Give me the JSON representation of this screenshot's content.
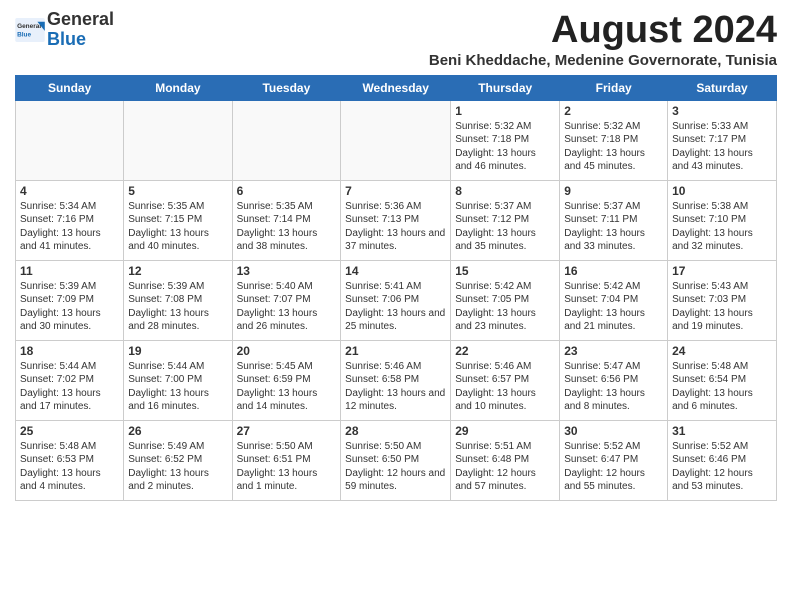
{
  "header": {
    "logo": {
      "general": "General",
      "blue": "Blue"
    },
    "title": "August 2024",
    "subtitle": "Beni Kheddache, Medenine Governorate, Tunisia"
  },
  "calendar": {
    "days_of_week": [
      "Sunday",
      "Monday",
      "Tuesday",
      "Wednesday",
      "Thursday",
      "Friday",
      "Saturday"
    ],
    "weeks": [
      [
        {
          "day": "",
          "empty": true
        },
        {
          "day": "",
          "empty": true
        },
        {
          "day": "",
          "empty": true
        },
        {
          "day": "",
          "empty": true
        },
        {
          "day": "1",
          "sunrise": "5:32 AM",
          "sunset": "7:18 PM",
          "daylight": "13 hours and 46 minutes."
        },
        {
          "day": "2",
          "sunrise": "5:32 AM",
          "sunset": "7:18 PM",
          "daylight": "13 hours and 45 minutes."
        },
        {
          "day": "3",
          "sunrise": "5:33 AM",
          "sunset": "7:17 PM",
          "daylight": "13 hours and 43 minutes."
        }
      ],
      [
        {
          "day": "4",
          "sunrise": "5:34 AM",
          "sunset": "7:16 PM",
          "daylight": "13 hours and 41 minutes."
        },
        {
          "day": "5",
          "sunrise": "5:35 AM",
          "sunset": "7:15 PM",
          "daylight": "13 hours and 40 minutes."
        },
        {
          "day": "6",
          "sunrise": "5:35 AM",
          "sunset": "7:14 PM",
          "daylight": "13 hours and 38 minutes."
        },
        {
          "day": "7",
          "sunrise": "5:36 AM",
          "sunset": "7:13 PM",
          "daylight": "13 hours and 37 minutes."
        },
        {
          "day": "8",
          "sunrise": "5:37 AM",
          "sunset": "7:12 PM",
          "daylight": "13 hours and 35 minutes."
        },
        {
          "day": "9",
          "sunrise": "5:37 AM",
          "sunset": "7:11 PM",
          "daylight": "13 hours and 33 minutes."
        },
        {
          "day": "10",
          "sunrise": "5:38 AM",
          "sunset": "7:10 PM",
          "daylight": "13 hours and 32 minutes."
        }
      ],
      [
        {
          "day": "11",
          "sunrise": "5:39 AM",
          "sunset": "7:09 PM",
          "daylight": "13 hours and 30 minutes."
        },
        {
          "day": "12",
          "sunrise": "5:39 AM",
          "sunset": "7:08 PM",
          "daylight": "13 hours and 28 minutes."
        },
        {
          "day": "13",
          "sunrise": "5:40 AM",
          "sunset": "7:07 PM",
          "daylight": "13 hours and 26 minutes."
        },
        {
          "day": "14",
          "sunrise": "5:41 AM",
          "sunset": "7:06 PM",
          "daylight": "13 hours and 25 minutes."
        },
        {
          "day": "15",
          "sunrise": "5:42 AM",
          "sunset": "7:05 PM",
          "daylight": "13 hours and 23 minutes."
        },
        {
          "day": "16",
          "sunrise": "5:42 AM",
          "sunset": "7:04 PM",
          "daylight": "13 hours and 21 minutes."
        },
        {
          "day": "17",
          "sunrise": "5:43 AM",
          "sunset": "7:03 PM",
          "daylight": "13 hours and 19 minutes."
        }
      ],
      [
        {
          "day": "18",
          "sunrise": "5:44 AM",
          "sunset": "7:02 PM",
          "daylight": "13 hours and 17 minutes."
        },
        {
          "day": "19",
          "sunrise": "5:44 AM",
          "sunset": "7:00 PM",
          "daylight": "13 hours and 16 minutes."
        },
        {
          "day": "20",
          "sunrise": "5:45 AM",
          "sunset": "6:59 PM",
          "daylight": "13 hours and 14 minutes."
        },
        {
          "day": "21",
          "sunrise": "5:46 AM",
          "sunset": "6:58 PM",
          "daylight": "13 hours and 12 minutes."
        },
        {
          "day": "22",
          "sunrise": "5:46 AM",
          "sunset": "6:57 PM",
          "daylight": "13 hours and 10 minutes."
        },
        {
          "day": "23",
          "sunrise": "5:47 AM",
          "sunset": "6:56 PM",
          "daylight": "13 hours and 8 minutes."
        },
        {
          "day": "24",
          "sunrise": "5:48 AM",
          "sunset": "6:54 PM",
          "daylight": "13 hours and 6 minutes."
        }
      ],
      [
        {
          "day": "25",
          "sunrise": "5:48 AM",
          "sunset": "6:53 PM",
          "daylight": "13 hours and 4 minutes."
        },
        {
          "day": "26",
          "sunrise": "5:49 AM",
          "sunset": "6:52 PM",
          "daylight": "13 hours and 2 minutes."
        },
        {
          "day": "27",
          "sunrise": "5:50 AM",
          "sunset": "6:51 PM",
          "daylight": "13 hours and 1 minute."
        },
        {
          "day": "28",
          "sunrise": "5:50 AM",
          "sunset": "6:50 PM",
          "daylight": "12 hours and 59 minutes."
        },
        {
          "day": "29",
          "sunrise": "5:51 AM",
          "sunset": "6:48 PM",
          "daylight": "12 hours and 57 minutes."
        },
        {
          "day": "30",
          "sunrise": "5:52 AM",
          "sunset": "6:47 PM",
          "daylight": "12 hours and 55 minutes."
        },
        {
          "day": "31",
          "sunrise": "5:52 AM",
          "sunset": "6:46 PM",
          "daylight": "12 hours and 53 minutes."
        }
      ]
    ]
  }
}
